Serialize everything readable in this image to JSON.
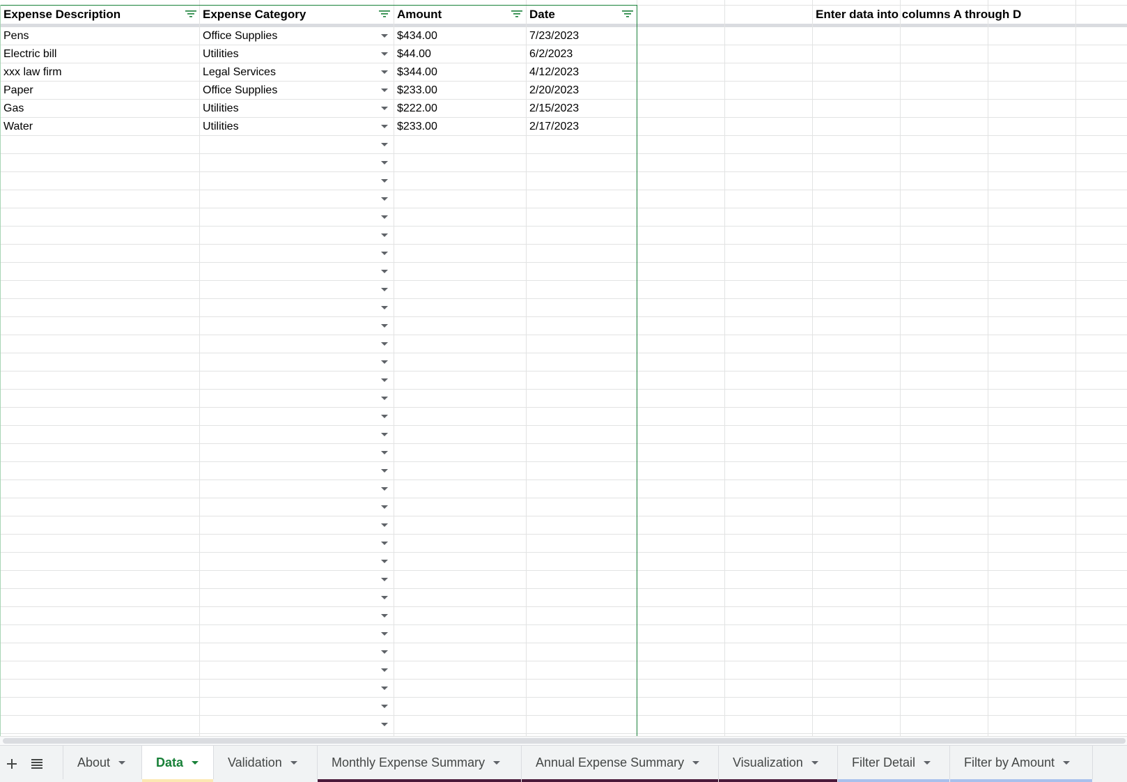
{
  "headers": {
    "col_a": "Expense Description",
    "col_b": "Expense Category",
    "col_c": "Amount",
    "col_d": "Date",
    "note": "Enter data into columns A through D"
  },
  "rows": [
    {
      "description": "Pens",
      "category": "Office Supplies",
      "amount": "$434.00",
      "date": "7/23/2023"
    },
    {
      "description": "Electric bill",
      "category": "Utilities",
      "amount": "$44.00",
      "date": "6/2/2023"
    },
    {
      "description": "xxx law firm",
      "category": "Legal Services",
      "amount": "$344.00",
      "date": "4/12/2023"
    },
    {
      "description": "Paper",
      "category": "Office Supplies",
      "amount": "$233.00",
      "date": "2/20/2023"
    },
    {
      "description": "Gas",
      "category": "Utilities",
      "amount": "$222.00",
      "date": "2/15/2023"
    },
    {
      "description": "Water",
      "category": "Utilities",
      "amount": "$233.00",
      "date": "2/17/2023"
    }
  ],
  "tabs": [
    {
      "label": "About",
      "active": false,
      "color": ""
    },
    {
      "label": "Data",
      "active": true,
      "color": "#fce8b2"
    },
    {
      "label": "Validation",
      "active": false,
      "color": ""
    },
    {
      "label": "Monthly Expense Summary",
      "active": false,
      "color": "#4a1a3a"
    },
    {
      "label": "Annual Expense Summary",
      "active": false,
      "color": "#4a1a3a"
    },
    {
      "label": "Visualization",
      "active": false,
      "color": "#4a1a3a"
    },
    {
      "label": "Filter Detail",
      "active": false,
      "color": "#a8c0ec"
    },
    {
      "label": "Filter by Amount",
      "active": false,
      "color": "#a8c0ec"
    }
  ],
  "toolbar": {
    "add_sheet_icon": "plus-icon",
    "all_sheets_icon": "list-icon"
  },
  "colors": {
    "filter_green": "#188038",
    "grid": "#e2e3e3"
  }
}
